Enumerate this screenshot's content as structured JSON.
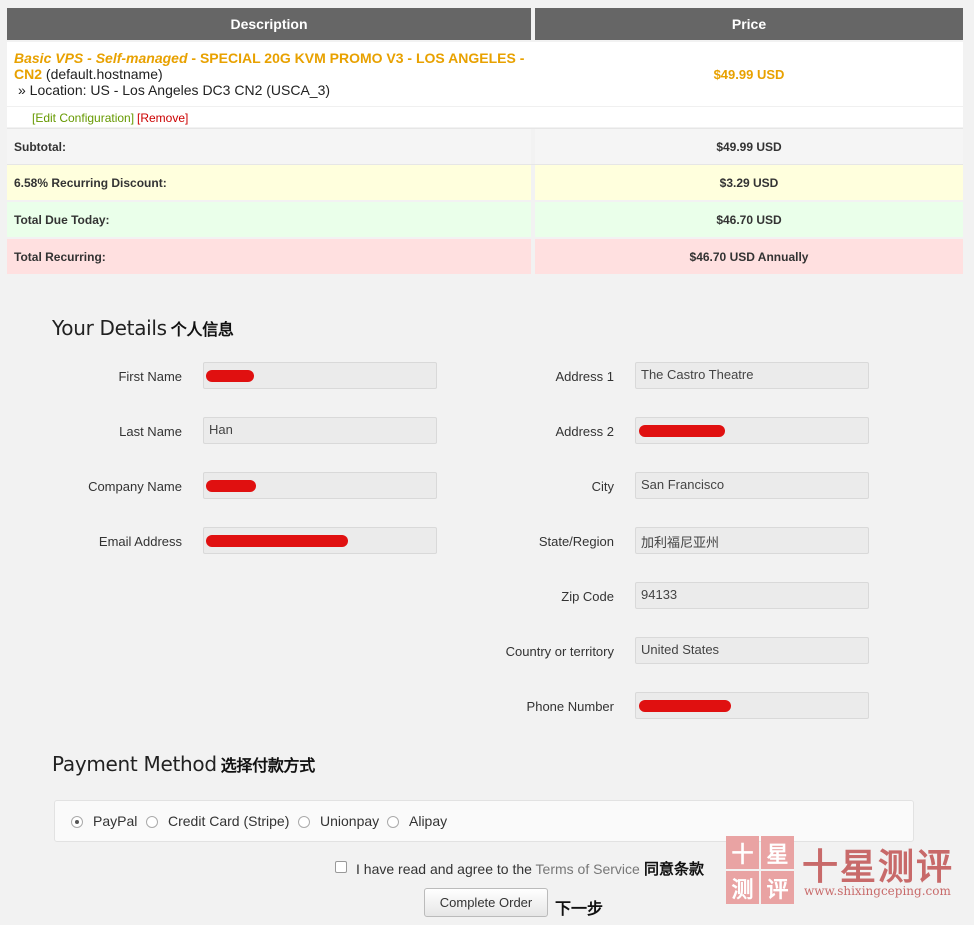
{
  "table": {
    "headers": {
      "description": "Description",
      "price": "Price"
    },
    "item": {
      "group": "Basic VPS - Self-managed",
      "dash": " - ",
      "name": "SPECIAL 20G KVM PROMO V3 - LOS ANGELES - CN2",
      "hostname": " (default.hostname)",
      "location": "» Location: US - Los Angeles DC3 CN2 (USCA_3)",
      "price": "$49.99 USD",
      "edit_link": "[Edit Configuration]",
      "remove_link": "[Remove]"
    },
    "summary": [
      {
        "label": "Subtotal:",
        "value": "$49.99 USD",
        "color": "#f5f5f5"
      },
      {
        "label": "6.58% Recurring Discount:",
        "value": "$3.29 USD",
        "color": "#ffffdd"
      },
      {
        "label": "Total Due Today:",
        "value": "$46.70 USD",
        "color": "#eaffea"
      },
      {
        "label": "Total Recurring:",
        "value": "$46.70 USD Annually",
        "color": "#ffe0e0"
      }
    ]
  },
  "details": {
    "title": "Your Details",
    "title_cn": "个人信息",
    "left_fields": [
      {
        "label": "First Name",
        "value": "",
        "redacted": true
      },
      {
        "label": "Last Name",
        "value": "Han",
        "redacted": false
      },
      {
        "label": "Company Name",
        "value": "",
        "redacted": true
      },
      {
        "label": "Email Address",
        "value": "",
        "redacted": true
      }
    ],
    "right_fields": [
      {
        "label": "Address 1",
        "value": "The Castro Theatre",
        "redacted": false
      },
      {
        "label": "Address 2",
        "value": "",
        "redacted": true
      },
      {
        "label": "City",
        "value": "San Francisco",
        "redacted": false
      },
      {
        "label": "State/Region",
        "value": "加利福尼亚州",
        "redacted": false
      },
      {
        "label": "Zip Code",
        "value": "94133",
        "redacted": false
      },
      {
        "label": "Country or territory",
        "value": "United States",
        "redacted": false
      },
      {
        "label": "Phone Number",
        "value": "",
        "redacted": true
      }
    ]
  },
  "payment": {
    "title": "Payment Method",
    "title_cn": "选择付款方式",
    "options": [
      "PayPal",
      "Credit Card (Stripe)",
      "Unionpay",
      "Alipay"
    ],
    "selected": "PayPal"
  },
  "terms": {
    "prefix": "I have read and agree to the ",
    "link": "Terms of Service",
    "cn": " 同意条款"
  },
  "submit": {
    "label": "Complete Order",
    "cn": "下一步"
  },
  "watermark": {
    "seal_chars": [
      "十",
      "星",
      "测",
      "评"
    ],
    "title": "十星测评",
    "url": "www.shixingceping.com"
  }
}
